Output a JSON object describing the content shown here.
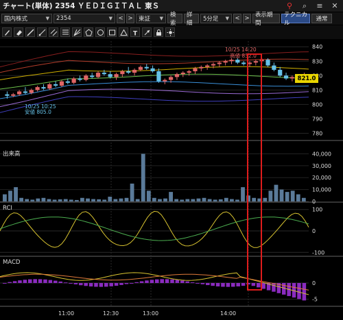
{
  "window": {
    "title": "チャート(単体) 2354 ＹＥＤＩＧＩＴＡＬ 東Ｓ",
    "icons": [
      "pin-icon",
      "search-icon",
      "menu-icon",
      "close-icon"
    ]
  },
  "toolbar": {
    "market_select": "国内株式",
    "code_input": "2354",
    "prev_label": "<",
    "next_label": ">",
    "exchange_select": "東証",
    "search_label": "検索",
    "detail_label": "詳細",
    "interval_select": "5分足",
    "period_label": "表示期間",
    "technical_label": "テクニカル",
    "normal_label": "通常"
  },
  "drawing_tools": [
    "pen-icon",
    "eraser-icon",
    "line-icon",
    "ray-icon",
    "channel-icon",
    "fib-icon",
    "fan-icon",
    "pentagon-icon",
    "circle-icon",
    "rect-icon",
    "triangle-icon",
    "text-icon",
    "arrow-icon",
    "lock-icon",
    "sun-icon"
  ],
  "colors": {
    "up": "#e06666",
    "down": "#66c2e8",
    "highlight": "#e01c1c",
    "price_tag": "#e8d500",
    "volume": "#5a7a99"
  },
  "chart_data": [
    {
      "type": "candlestick",
      "title": "",
      "y_ticks": [
        "840",
        "830",
        "820",
        "810",
        "800",
        "790",
        "780"
      ],
      "ylim": [
        775,
        842
      ],
      "current_price": "821.0",
      "annotations": {
        "high": "10/25 14:20",
        "high_value": "高値 832.0",
        "low": "10/25 10:25",
        "low_value": "安値 805.0"
      },
      "candles": [
        [
          807,
          809,
          804,
          806
        ],
        [
          806,
          808,
          805,
          807
        ],
        [
          807,
          810,
          806,
          809
        ],
        [
          809,
          812,
          807,
          808
        ],
        [
          808,
          811,
          807,
          810
        ],
        [
          810,
          813,
          809,
          812
        ],
        [
          812,
          814,
          810,
          811
        ],
        [
          811,
          815,
          810,
          814
        ],
        [
          814,
          816,
          812,
          813
        ],
        [
          813,
          817,
          812,
          816
        ],
        [
          816,
          818,
          814,
          815
        ],
        [
          815,
          819,
          814,
          818
        ],
        [
          818,
          820,
          816,
          817
        ],
        [
          817,
          821,
          816,
          820
        ],
        [
          820,
          822,
          818,
          819
        ],
        [
          819,
          823,
          818,
          822
        ],
        [
          822,
          824,
          820,
          821
        ],
        [
          821,
          823,
          818,
          819
        ],
        [
          819,
          822,
          817,
          821
        ],
        [
          821,
          824,
          819,
          823
        ],
        [
          823,
          826,
          821,
          822
        ],
        [
          822,
          825,
          820,
          824
        ],
        [
          824,
          827,
          823,
          826
        ],
        [
          826,
          828,
          824,
          825
        ],
        [
          825,
          827,
          822,
          823
        ],
        [
          823,
          825,
          815,
          816
        ],
        [
          816,
          818,
          814,
          817
        ],
        [
          817,
          820,
          815,
          819
        ],
        [
          819,
          822,
          817,
          821
        ],
        [
          821,
          823,
          819,
          822
        ],
        [
          822,
          824,
          820,
          823
        ],
        [
          823,
          826,
          821,
          825
        ],
        [
          825,
          827,
          823,
          826
        ],
        [
          826,
          828,
          824,
          827
        ],
        [
          827,
          829,
          825,
          828
        ],
        [
          828,
          830,
          826,
          829
        ],
        [
          829,
          831,
          827,
          830
        ],
        [
          830,
          832,
          828,
          831
        ],
        [
          831,
          832,
          828,
          829
        ],
        [
          829,
          830,
          827,
          828
        ],
        [
          828,
          830,
          826,
          829
        ],
        [
          829,
          831,
          827,
          830
        ],
        [
          830,
          832,
          828,
          831
        ],
        [
          831,
          832,
          826,
          827
        ],
        [
          827,
          829,
          823,
          824
        ],
        [
          824,
          826,
          819,
          820
        ],
        [
          820,
          822,
          817,
          818
        ],
        [
          818,
          820,
          816,
          819
        ],
        [
          819,
          821,
          817,
          820
        ],
        [
          820,
          822,
          818,
          821
        ]
      ]
    },
    {
      "type": "bar",
      "title": "出来高",
      "y_ticks": [
        "40,000",
        "30,000",
        "20,000",
        "10,000",
        "0"
      ],
      "ylim": [
        0,
        42000
      ],
      "values": [
        6000,
        9000,
        12000,
        3000,
        2000,
        1500,
        2500,
        3000,
        2000,
        1500,
        1800,
        2000,
        1500,
        1200,
        3000,
        2500,
        2000,
        1800,
        1500,
        4000,
        2000,
        2500,
        3000,
        15000,
        2000,
        40000,
        9000,
        3000,
        2000,
        2500,
        8000,
        2000,
        1500,
        2000,
        2000,
        2500,
        3000,
        2000,
        1500,
        1800,
        3000,
        2000,
        1500,
        12000,
        5000,
        3000,
        2500,
        3000,
        9000,
        14000,
        10000,
        8000,
        9000,
        6000,
        3000
      ]
    },
    {
      "type": "line",
      "title": "RCI",
      "y_ticks": [
        "100",
        "0",
        "-100"
      ],
      "ylim": [
        -115,
        115
      ]
    },
    {
      "type": "bar",
      "title": "MACD",
      "y_ticks": [
        "0",
        "-5"
      ],
      "ylim": [
        -7,
        7
      ]
    }
  ],
  "x_axis": {
    "ticks": [
      "11:00",
      "12:30",
      "13:00",
      "14:00"
    ]
  }
}
